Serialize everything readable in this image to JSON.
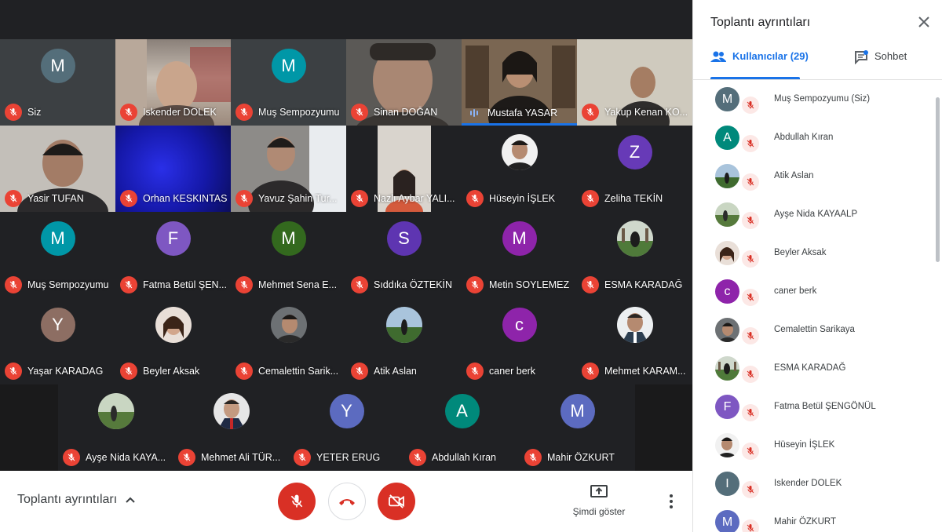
{
  "grid": {
    "tiles": [
      {
        "name": "Siz",
        "initial": "M",
        "color": "#546e7a",
        "kind": "initial",
        "mic": "muted"
      },
      {
        "name": "Iskender DOLEK",
        "kind": "video",
        "mic": "muted"
      },
      {
        "name": "Muş Sempozyumu",
        "initial": "M",
        "color": "#0097a7",
        "kind": "initial",
        "mic": "muted"
      },
      {
        "name": "Sinan DOĞAN",
        "kind": "video",
        "mic": "muted"
      },
      {
        "name": "Mustafa YASAR",
        "kind": "video",
        "mic": "speaking"
      },
      {
        "name": "Yakup Kenan KO...",
        "kind": "video",
        "mic": "muted"
      },
      {
        "name": "Yasir TUFAN",
        "kind": "video",
        "mic": "muted"
      },
      {
        "name": "Orhan KESKINTAS",
        "kind": "video",
        "mic": "muted"
      },
      {
        "name": "Yavuz Şahin Tur...",
        "kind": "video",
        "mic": "muted"
      },
      {
        "name": "Nazlı Aybar YALI...",
        "kind": "video",
        "mic": "muted"
      },
      {
        "name": "Hüseyin İŞLEK",
        "kind": "photo",
        "mic": "muted"
      },
      {
        "name": "Zeliha TEKİN",
        "initial": "Z",
        "color": "#673ab7",
        "kind": "initial",
        "mic": "muted"
      },
      {
        "name": "Muş Sempozyumu",
        "initial": "M",
        "color": "#0097a7",
        "kind": "initial",
        "mic": "muted"
      },
      {
        "name": "Fatma Betül ŞEN...",
        "initial": "F",
        "color": "#7e57c2",
        "kind": "initial",
        "mic": "muted"
      },
      {
        "name": "Mehmet Sena E...",
        "initial": "M",
        "color": "#33691e",
        "kind": "initial",
        "mic": "muted"
      },
      {
        "name": "Sıddıka ÖZTEKİN",
        "initial": "S",
        "color": "#5e35b1",
        "kind": "initial",
        "mic": "muted"
      },
      {
        "name": "Metin SOYLEMEZ",
        "initial": "M",
        "color": "#8e24aa",
        "kind": "initial",
        "mic": "muted"
      },
      {
        "name": "ESMA KARADAĞ",
        "kind": "photo",
        "mic": "muted"
      },
      {
        "name": "Yaşar KARADAG",
        "initial": "Y",
        "color": "#8d6e63",
        "kind": "initial",
        "mic": "muted"
      },
      {
        "name": "Beyler Aksak",
        "kind": "photo",
        "mic": "muted"
      },
      {
        "name": "Cemalettin Sarik...",
        "kind": "photo",
        "mic": "muted"
      },
      {
        "name": "Atik Aslan",
        "kind": "photo",
        "mic": "muted"
      },
      {
        "name": "caner berk",
        "initial": "c",
        "color": "#8e24aa",
        "kind": "initial",
        "mic": "muted"
      },
      {
        "name": "Mehmet KARAM...",
        "kind": "photo",
        "mic": "muted"
      },
      {
        "name": "Ayşe Nida KAYA...",
        "kind": "photo",
        "mic": "muted"
      },
      {
        "name": "Mehmet Ali TÜR...",
        "kind": "photo",
        "mic": "muted"
      },
      {
        "name": "YETER ERUG",
        "initial": "Y",
        "color": "#5c6bc0",
        "kind": "initial",
        "mic": "muted"
      },
      {
        "name": "Abdullah Kıran",
        "initial": "A",
        "color": "#00897b",
        "kind": "initial",
        "mic": "muted"
      },
      {
        "name": "Mahir ÖZKURT",
        "initial": "M",
        "color": "#5c6bc0",
        "kind": "initial",
        "mic": "muted"
      }
    ]
  },
  "bottom_bar": {
    "meeting_details_label": "Toplantı ayrıntıları",
    "present_now_label": "Şimdi göster"
  },
  "panel": {
    "title": "Toplantı ayrıntıları",
    "tab_people_label": "Kullanıcılar (29)",
    "tab_chat_label": "Sohbet",
    "people": [
      {
        "name": "Muş Sempozyumu (Siz)",
        "initial": "M",
        "color": "#546e7a",
        "kind": "initial"
      },
      {
        "name": "Abdullah Kıran",
        "initial": "A",
        "color": "#00897b",
        "kind": "initial"
      },
      {
        "name": "Atik Aslan",
        "kind": "photo"
      },
      {
        "name": "Ayşe Nida KAYAALP",
        "kind": "photo"
      },
      {
        "name": "Beyler Aksak",
        "kind": "photo"
      },
      {
        "name": "caner berk",
        "initial": "c",
        "color": "#8e24aa",
        "kind": "initial"
      },
      {
        "name": "Cemalettin Sarikaya",
        "kind": "photo"
      },
      {
        "name": "ESMA KARADAĞ",
        "kind": "photo"
      },
      {
        "name": "Fatma Betül ŞENGÖNÜL",
        "initial": "F",
        "color": "#7e57c2",
        "kind": "initial"
      },
      {
        "name": "Hüseyin İŞLEK",
        "kind": "photo"
      },
      {
        "name": "Iskender DOLEK",
        "initial": "I",
        "color": "#546e7a",
        "kind": "initial"
      },
      {
        "name": "Mahir ÖZKURT",
        "initial": "M",
        "color": "#5c6bc0",
        "kind": "initial"
      }
    ]
  },
  "colors": {
    "accent": "#1a73e8",
    "muted_red": "#ea4335",
    "stage_bg": "#202124"
  }
}
